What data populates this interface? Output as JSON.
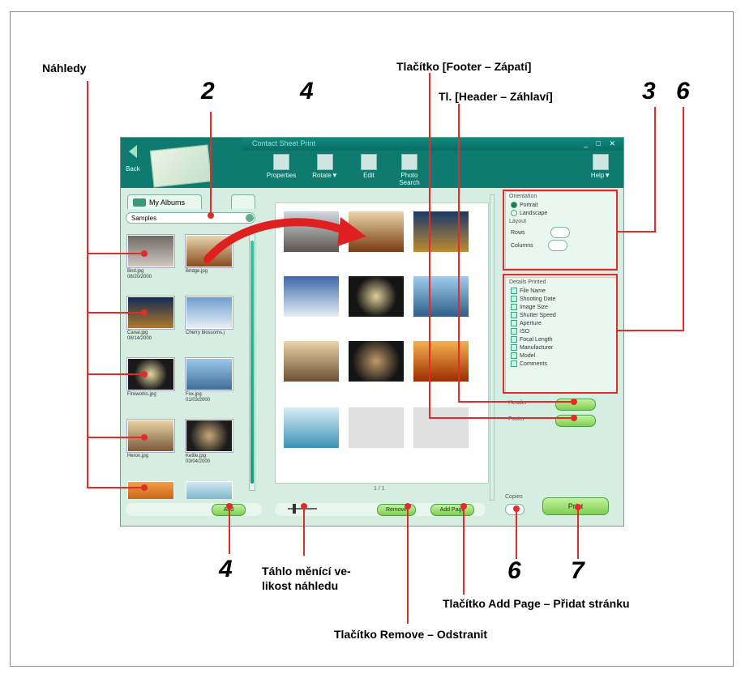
{
  "labels": {
    "nahledy": "Náhledy",
    "footer_button": "Tlačítko [Footer – Zápatí]",
    "header_button": "Tl. [Header – Záhlaví]",
    "slider": "Táhlo měnící ve-\nlikost náhledu",
    "add_page_button": "Tlačítko Add Page – Přidat stránku",
    "remove_button": "Tlačítko Remove – Odstranit"
  },
  "numbers": {
    "n2": "2",
    "n4_top": "4",
    "n3": "3",
    "n6_top": "6",
    "n4_bottom": "4",
    "n6_bottom": "6",
    "n7": "7"
  },
  "app": {
    "title": "Contact Sheet Print",
    "back_label": "Back",
    "toolbar": [
      "Properties",
      "Rotate▼",
      "Edit",
      "Photo Search"
    ],
    "help_label": "Help▼",
    "tab_label": "My Albums",
    "combo_value": "Samples",
    "thumbnails": [
      {
        "caption": "Bird.jpg\n08/20/2000"
      },
      {
        "caption": "Bridge.jpg"
      },
      {
        "caption": "Canal.jpg\n08/14/2000"
      },
      {
        "caption": "Cherry blossoms.j"
      },
      {
        "caption": "Fireworks.jpg"
      },
      {
        "caption": "Fox.jpg\n01/03/2000"
      },
      {
        "caption": "Heron.jpg"
      },
      {
        "caption": "Kettle.jpg\n03/04/2000"
      },
      {
        "caption": ""
      },
      {
        "caption": ""
      }
    ],
    "add_label": "Add",
    "remove_label": "Remove",
    "add_page_label": "Add Page",
    "page_indicator": "1 / 1",
    "print_label": "Print",
    "copies_label": "Copies",
    "orientation": {
      "title": "Orientation",
      "portrait": "Portrait",
      "landscape": "Landscape"
    },
    "layout": {
      "title": "Layout",
      "rows": "Rows",
      "columns": "Columns"
    },
    "details": {
      "title": "Details Printed",
      "items": [
        "File Name",
        "Shooting Date",
        "Image Size",
        "Shutter Speed",
        "Aperture",
        "ISO",
        "Focal Length",
        "Manufacturer",
        "Model",
        "Comments"
      ]
    },
    "header_label": "Header",
    "footer_label": "Footer"
  },
  "colors": {
    "accent_red": "#e52a2a",
    "window_bg": "#d6ede2",
    "toolbar_teal": "#0f7a70"
  }
}
